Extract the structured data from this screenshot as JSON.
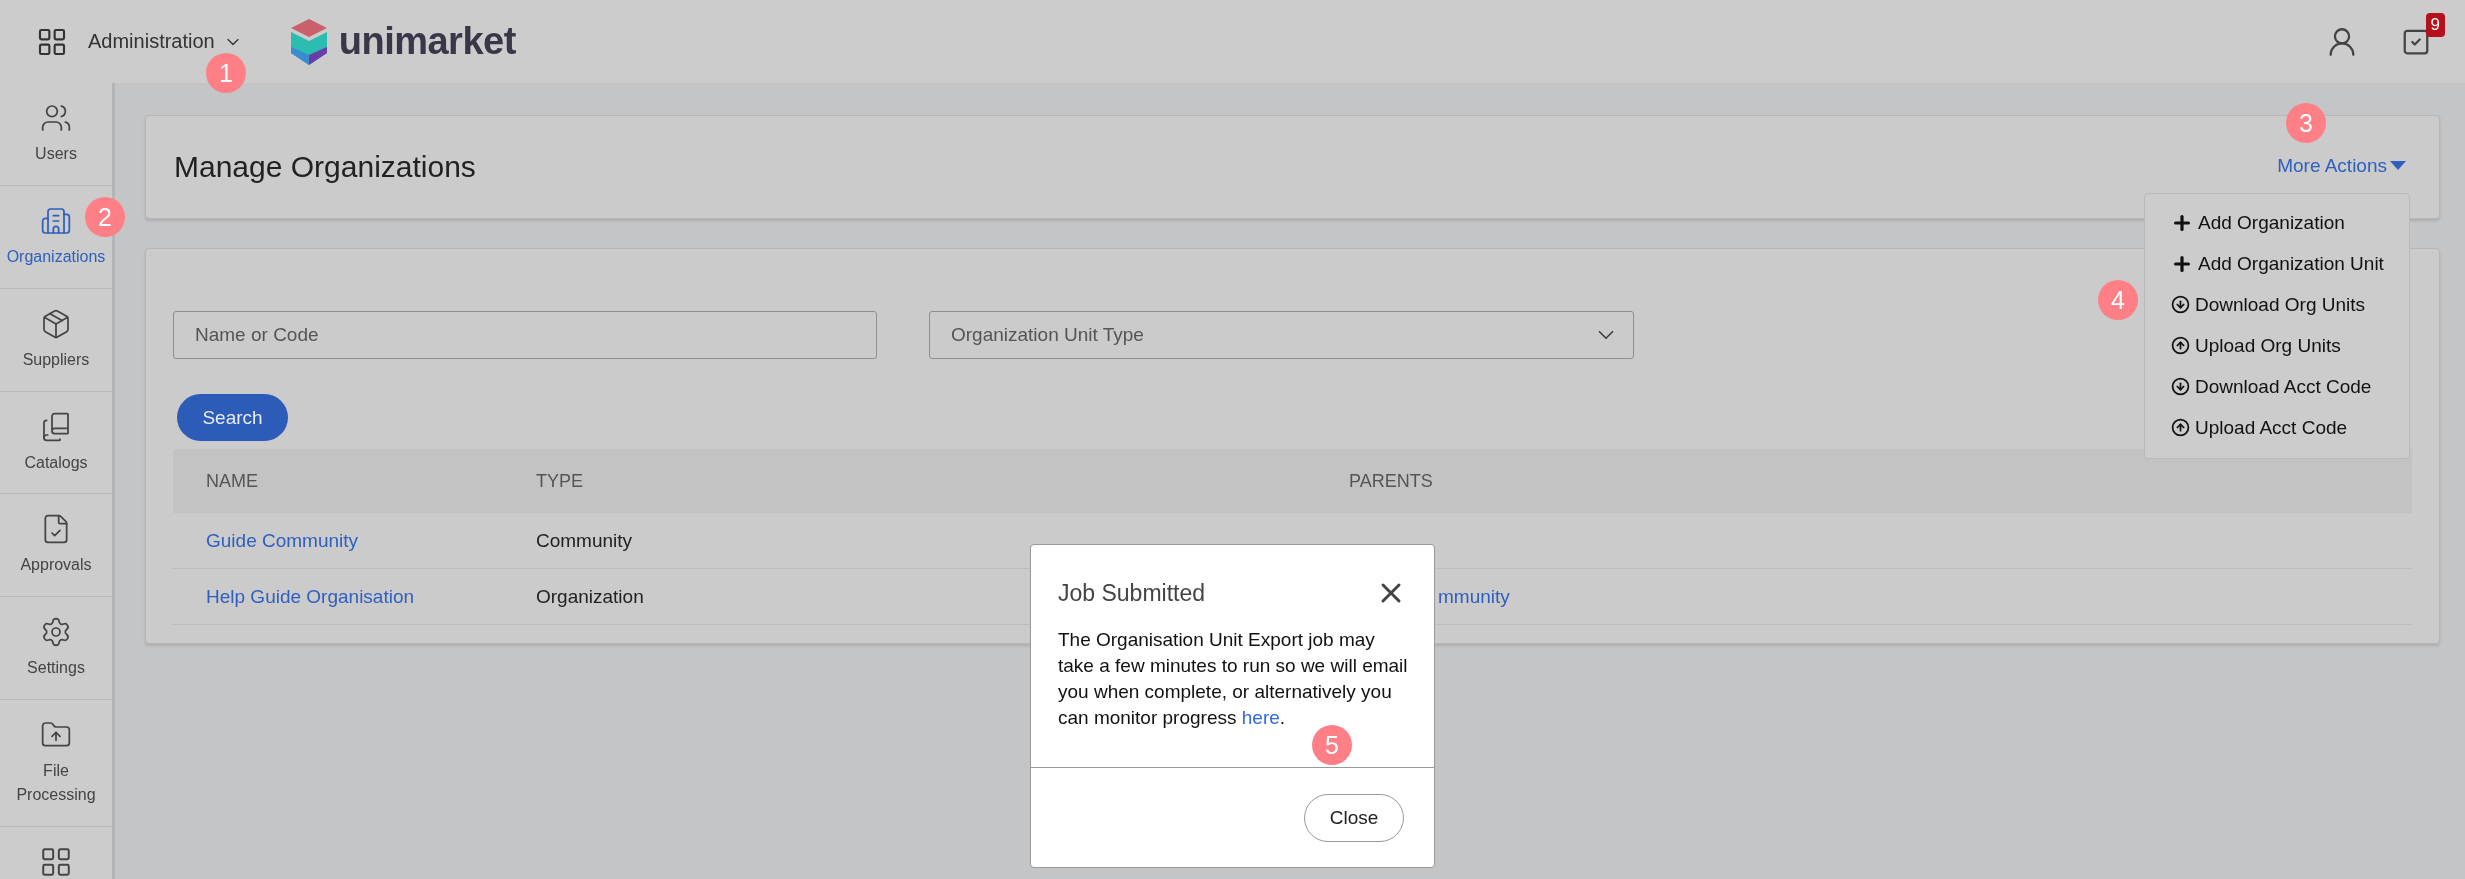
{
  "header": {
    "app_menu": "Administration",
    "logo": "unimarket",
    "notification_count": "9"
  },
  "sidebar": {
    "items": [
      {
        "label": "Users",
        "selected": false
      },
      {
        "label": "Organizations",
        "selected": true
      },
      {
        "label": "Suppliers",
        "selected": false
      },
      {
        "label": "Catalogs",
        "selected": false
      },
      {
        "label": "Approvals",
        "selected": false
      },
      {
        "label": "Settings",
        "selected": false
      },
      {
        "label": "File Processing",
        "selected": false
      }
    ]
  },
  "page": {
    "title": "Manage Organizations",
    "more_actions": "More Actions",
    "menu": [
      {
        "kind": "add",
        "label": "Add Organization"
      },
      {
        "kind": "add",
        "label": "Add Organization Unit"
      },
      {
        "kind": "download",
        "label": "Download Org Units"
      },
      {
        "kind": "upload",
        "label": "Upload Org Units"
      },
      {
        "kind": "download",
        "label": "Download Acct Code"
      },
      {
        "kind": "upload",
        "label": "Upload Acct Code"
      }
    ]
  },
  "filters": {
    "name": {
      "placeholder": "Name or Code"
    },
    "type": {
      "placeholder": "Organization Unit Type"
    },
    "search_button": "Search"
  },
  "table": {
    "columns": [
      "NAME",
      "TYPE",
      "PARENTS"
    ],
    "rows": [
      {
        "name": "Guide Community",
        "type": "Community"
      },
      {
        "name": "Help Guide Organisation",
        "type": "Organization",
        "parents": "mmunity"
      }
    ]
  },
  "modal": {
    "title": "Job Submitted",
    "body": "The Organisation Unit Export job may take a few minutes to run so we will email you when complete, or alternatively you can monitor progress",
    "link": "here",
    "after_link": ".",
    "close_button": "Close"
  },
  "annotations": [
    "1",
    "2",
    "3",
    "4",
    "5"
  ]
}
